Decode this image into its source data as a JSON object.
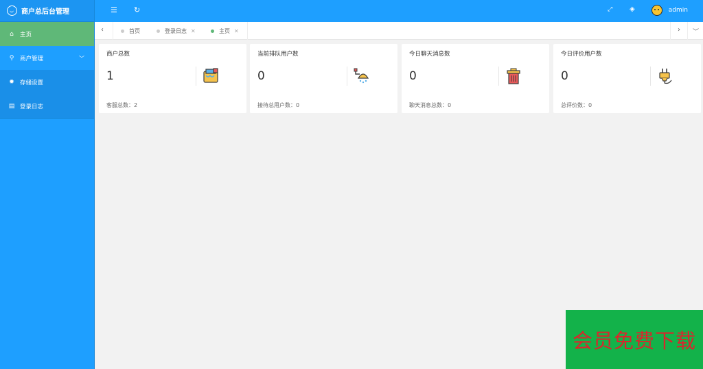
{
  "app": {
    "title": "商户总后台管理"
  },
  "sidebar": {
    "items": [
      {
        "label": "主页",
        "icon": "home-icon",
        "active": true
      },
      {
        "label": "商户管理",
        "icon": "user-icon",
        "expandable": true
      },
      {
        "label": "存储设置",
        "icon": "gear-icon"
      },
      {
        "label": "登录日志",
        "icon": "calendar-icon"
      }
    ]
  },
  "header": {
    "user_name": "admin"
  },
  "tabs": [
    {
      "label": "首页",
      "closable": false
    },
    {
      "label": "登录日志",
      "closable": true
    },
    {
      "label": "主页",
      "closable": true,
      "current": true
    }
  ],
  "cards": [
    {
      "title": "商户总数",
      "value": "1",
      "footer": "客服总数：2",
      "icon": "paint-bucket-icon"
    },
    {
      "title": "当前排队用户数",
      "value": "0",
      "footer": "接待总用户数：0",
      "icon": "shower-icon"
    },
    {
      "title": "今日聊天消息数",
      "value": "0",
      "footer": "聊天消息总数：0",
      "icon": "trash-bin-icon"
    },
    {
      "title": "今日评价用户数",
      "value": "0",
      "footer": "总评价数：0",
      "icon": "plug-icon"
    }
  ],
  "watermark": {
    "text": "会员免费下载"
  },
  "colors": {
    "primary": "#1e9fff",
    "active": "#5fb878",
    "watermark_bg": "#13b24a",
    "watermark_text": "#d9262c"
  }
}
